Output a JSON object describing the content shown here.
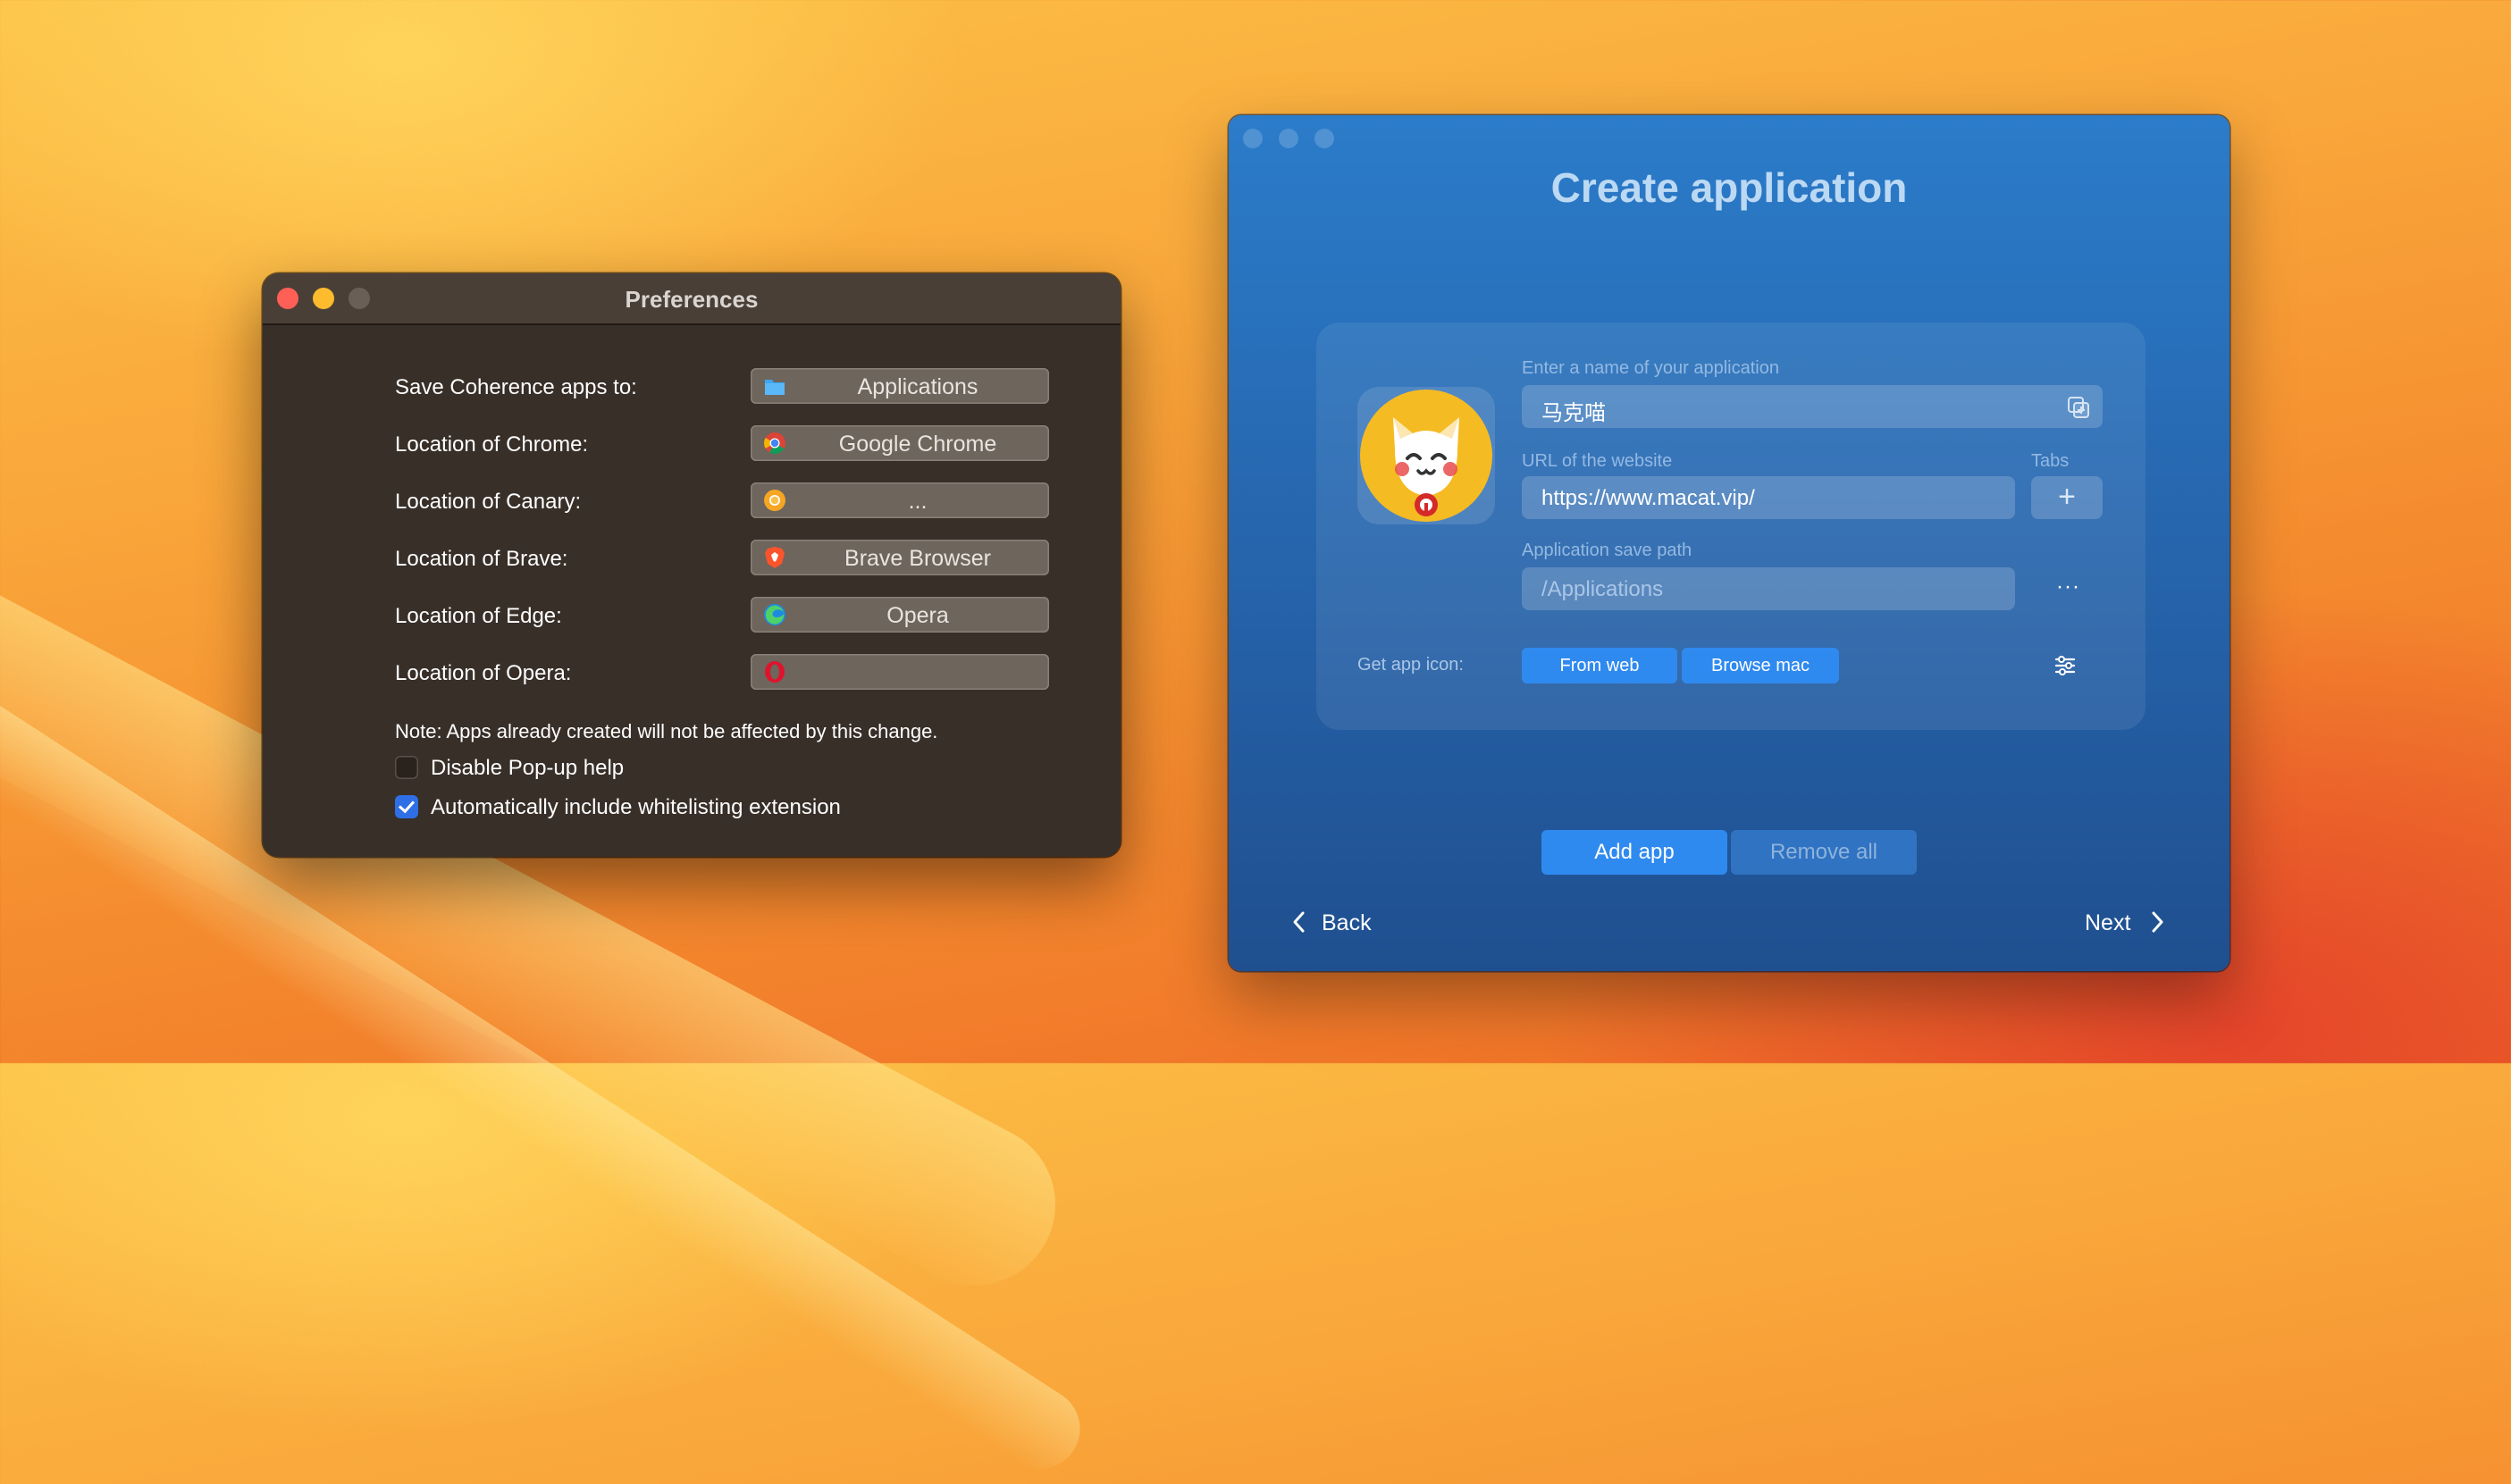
{
  "preferences": {
    "title": "Preferences",
    "rows": [
      {
        "label": "Save Coherence apps to:",
        "button": "Applications",
        "icon": "folder-icon"
      },
      {
        "label": "Location of Chrome:",
        "button": "Google Chrome",
        "icon": "chrome-icon"
      },
      {
        "label": "Location of Canary:",
        "button": "...",
        "icon": "chrome-canary-icon"
      },
      {
        "label": "Location of Brave:",
        "button": "Brave Browser",
        "icon": "brave-icon"
      },
      {
        "label": "Location of Edge:",
        "button": "Opera",
        "icon": "edge-icon"
      },
      {
        "label": "Location of Opera:",
        "button": "",
        "icon": "opera-icon"
      }
    ],
    "note": "Note: Apps already created will not be affected by this change.",
    "checkboxes": [
      {
        "label": "Disable Pop-up help",
        "checked": false
      },
      {
        "label": "Automatically include whitelisting extension",
        "checked": true
      }
    ]
  },
  "create": {
    "title": "Create application",
    "name_label": "Enter a name of your application",
    "name_value": "马克喵",
    "url_label": "URL of the website",
    "tabs_label": "Tabs",
    "url_value": "https://www.macat.vip/",
    "tabs_add": "+",
    "path_label": "Application save path",
    "path_value": "/Applications",
    "path_more": "···",
    "icon_label": "Get app icon:",
    "from_web": "From web",
    "browse_mac": "Browse mac",
    "add_app": "Add app",
    "remove_all": "Remove all",
    "back": "Back",
    "next": "Next"
  },
  "colors": {
    "accent_blue": "#2f8af0",
    "window_blue": "#2665ad",
    "prefs_bg": "#372f28"
  }
}
